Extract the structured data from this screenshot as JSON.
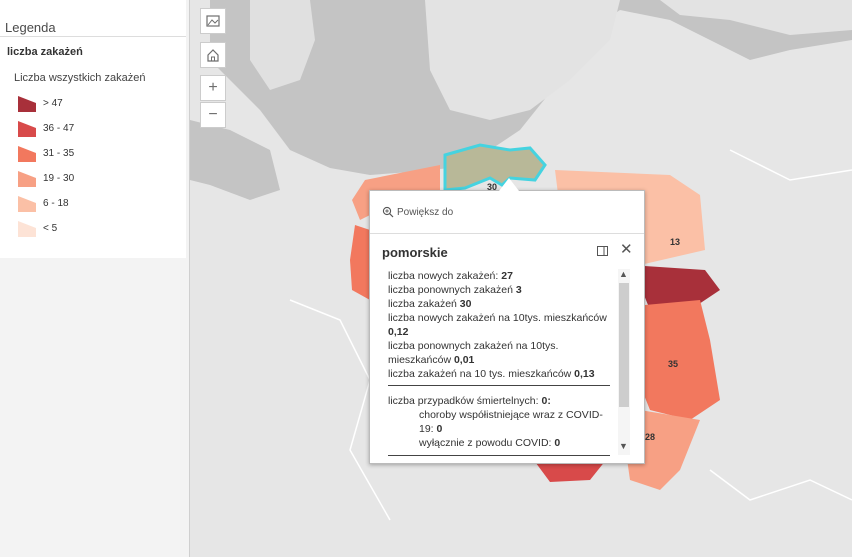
{
  "legend": {
    "title": "Legenda",
    "layer_name": "liczba zakażeń",
    "field_name": "Liczba wszystkich zakażeń",
    "items": [
      {
        "label": "> 47",
        "color": "#a8303a"
      },
      {
        "label": "36 - 47",
        "color": "#d84a4a"
      },
      {
        "label": "31 - 35",
        "color": "#f2785e"
      },
      {
        "label": "19 - 30",
        "color": "#f7a084"
      },
      {
        "label": "6 - 18",
        "color": "#fbc0a6"
      },
      {
        "label": "< 5",
        "color": "#fde3d6"
      }
    ]
  },
  "map_controls": {
    "basemap_icon": "basemap-gallery-icon",
    "home_icon": "home-icon",
    "zoom_in": "+",
    "zoom_out": "−"
  },
  "map_labels": {
    "pomorskie": "30",
    "region_east": "13",
    "region_lubelskie": "35",
    "region_southeast": "28"
  },
  "popup": {
    "zoom_to": "Powiększ do",
    "title": "pomorskie",
    "rows": {
      "new_label": "liczba nowych zakażeń: ",
      "new_value": "27",
      "re_label": "liczba ponownych zakażeń ",
      "re_value": "3",
      "total_label": "liczba zakażeń ",
      "total_value": "30",
      "new10_label": "liczba nowych zakażeń na 10tys. mieszkańców ",
      "new10_value": "0,12",
      "re10_label": "liczba ponownych  zakażeń na 10tys. mieszkańców ",
      "re10_value": "0,01",
      "total10_label": "liczba zakażeń na 10 tys. mieszkańców ",
      "total10_value": "0,13",
      "deaths_label": "liczba przypadków śmiertelnych: ",
      "deaths_value": "0:",
      "comorb_label": "choroby współistniejące wraz z COVID-19: ",
      "comorb_value": "0",
      "covid_label": "wyłącznie z powodu COVID: ",
      "covid_value": "0"
    }
  },
  "colors": {
    "sea": "#c4c4c4",
    "land": "#e6e6e6",
    "selected_outline": "#45d3e0",
    "selected_fill": "#b8b898"
  }
}
